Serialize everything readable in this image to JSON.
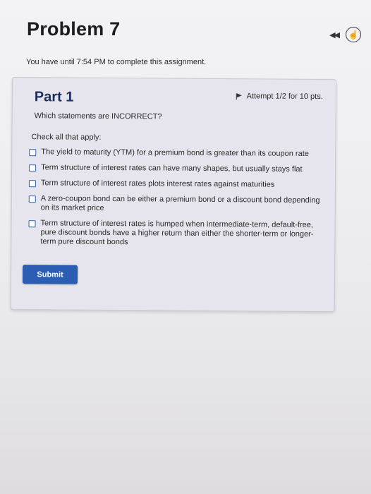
{
  "page": {
    "title": "Problem 7",
    "deadline": "You have until 7:54 PM to complete this assignment."
  },
  "icons": {
    "rewind": "rewind-icon",
    "hand": "hand-icon",
    "flag": "flag-icon"
  },
  "part": {
    "title": "Part 1",
    "attempt": "Attempt 1/2 for 10 pts.",
    "question": "Which statements are INCORRECT?",
    "instruction": "Check all that apply:",
    "options": [
      {
        "label": "The yield to maturity (YTM) for a premium bond is greater than its coupon rate"
      },
      {
        "label": "Term structure of interest rates can have many shapes, but usually stays flat"
      },
      {
        "label": "Term structure of interest rates plots interest rates against maturities"
      },
      {
        "label": "A zero-coupon bond can be either a premium bond or a discount bond depending on its market price"
      },
      {
        "label": "Term structure of interest rates is humped when intermediate-term, default-free, pure discount bonds have a higher return than either the shorter-term or longer-term pure discount bonds"
      }
    ],
    "submit_label": "Submit"
  },
  "colors": {
    "accent": "#2b5db3",
    "part_title": "#1e2d5c",
    "card_background": "#e6e5ed"
  }
}
